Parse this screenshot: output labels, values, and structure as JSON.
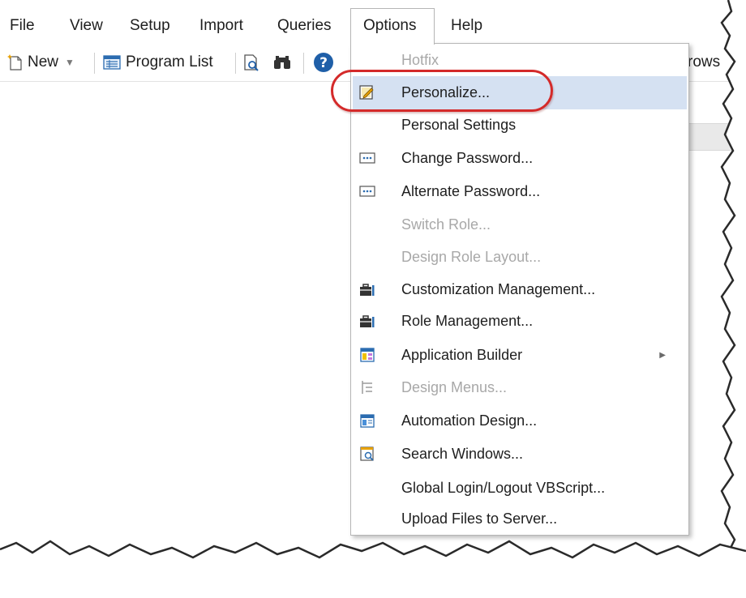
{
  "menubar": {
    "items": [
      "File",
      "View",
      "Setup",
      "Import",
      "Queries",
      "Options",
      "Help"
    ]
  },
  "toolbar": {
    "new_label": "New",
    "program_list_label": "Program List",
    "browse_fragment": "rows"
  },
  "options_menu": {
    "items": [
      {
        "label": "Hotfix",
        "disabled": true,
        "icon": null
      },
      {
        "label": "Personalize...",
        "disabled": false,
        "icon": "personalize-icon",
        "highlighted": true
      },
      {
        "label": "Personal Settings",
        "disabled": false,
        "icon": null
      },
      {
        "label": "Change Password...",
        "disabled": false,
        "icon": "password-icon"
      },
      {
        "label": "Alternate Password...",
        "disabled": false,
        "icon": "password-icon"
      },
      {
        "label": "Switch Role...",
        "disabled": true,
        "icon": null
      },
      {
        "label": "Design Role Layout...",
        "disabled": true,
        "icon": null
      },
      {
        "label": "Customization Management...",
        "disabled": false,
        "icon": "toolbox-icon"
      },
      {
        "label": "Role Management...",
        "disabled": false,
        "icon": "toolbox-icon"
      },
      {
        "label": "Application Builder",
        "disabled": false,
        "icon": "application-builder-icon",
        "has_submenu": true
      },
      {
        "label": "Design Menus...",
        "disabled": true,
        "icon": "design-menus-icon"
      },
      {
        "label": "Automation Design...",
        "disabled": false,
        "icon": "automation-design-icon"
      },
      {
        "label": "Search Windows...",
        "disabled": false,
        "icon": "search-windows-icon"
      },
      {
        "label": "Global Login/Logout VBScript...",
        "disabled": false,
        "icon": null
      },
      {
        "label": "Upload Files to Server...",
        "disabled": false,
        "icon": null
      }
    ]
  },
  "colors": {
    "highlight": "#d5e1f2",
    "annotation": "#d42a2a",
    "disabled_text": "#a8a8a8",
    "help_icon": "#1f5fa8"
  }
}
